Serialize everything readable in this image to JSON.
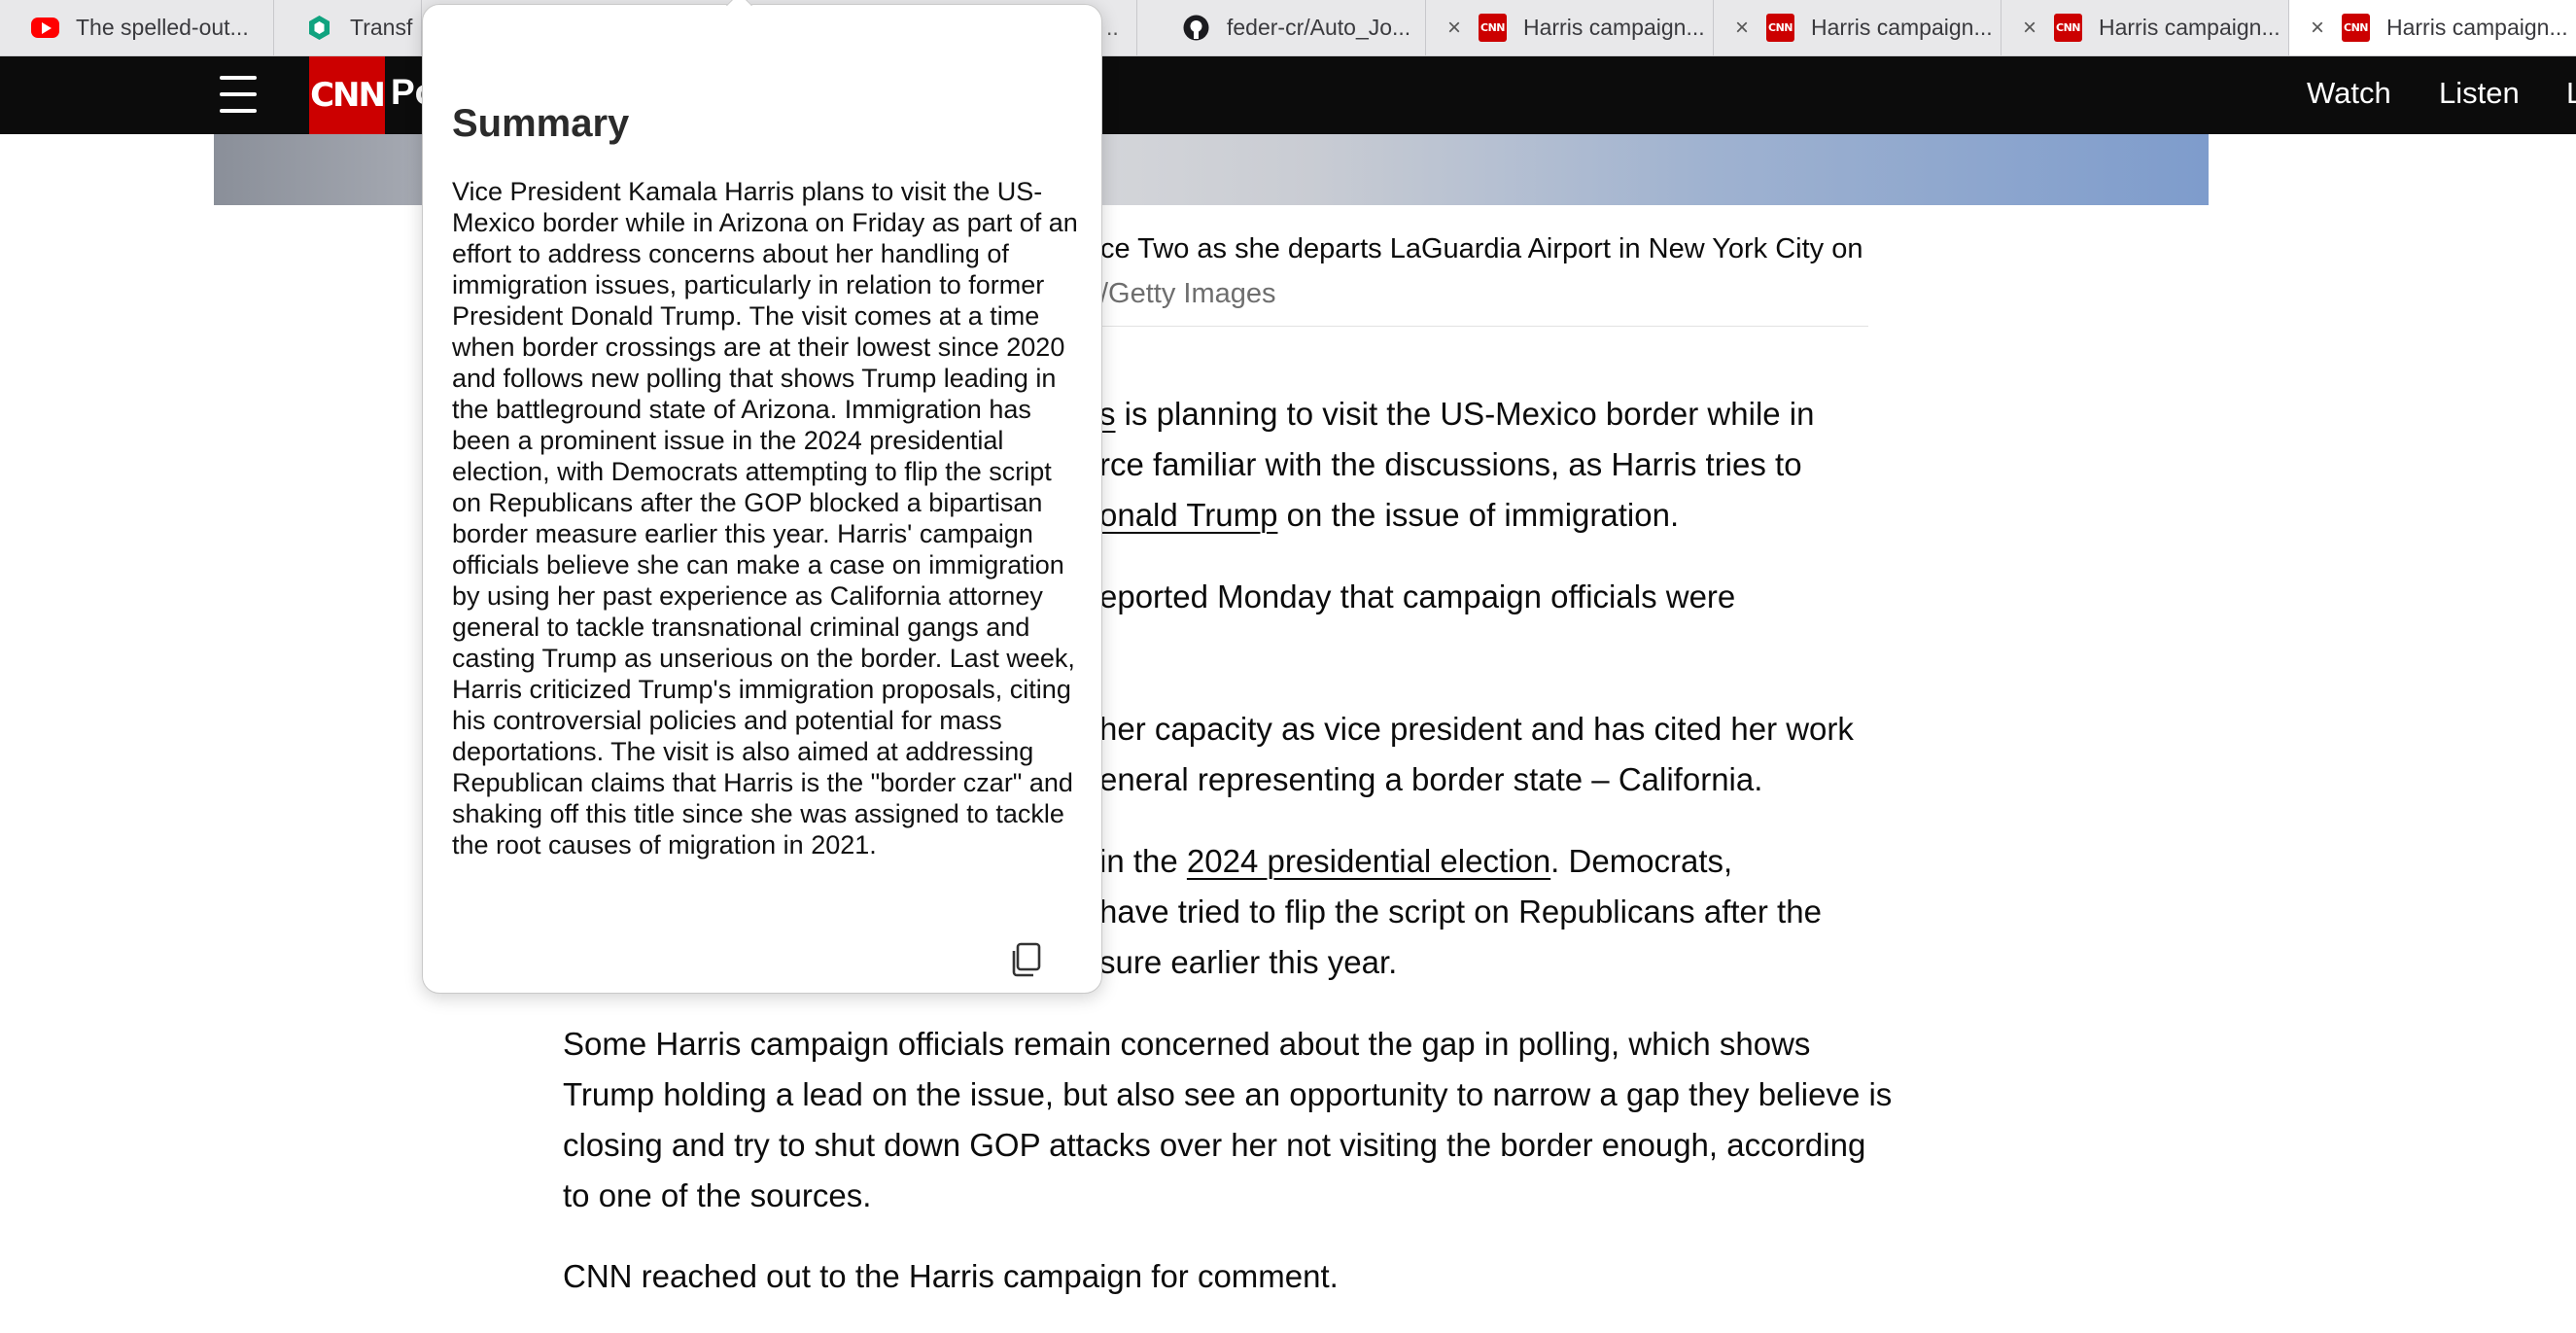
{
  "tabs": [
    {
      "label": "The spelled-out...",
      "icon": "youtube-icon",
      "active": false
    },
    {
      "label": "Transf",
      "icon": "chatgpt-icon",
      "active": false
    },
    {
      "label": "",
      "icon": "",
      "active": false
    },
    {
      "label": "feder-cr/Auto_Jo...",
      "icon": "github-icon",
      "active": false
    },
    {
      "label": "Harris campaign...",
      "icon": "cnn-icon",
      "active": false
    },
    {
      "label": "Harris campaign...",
      "icon": "cnn-icon",
      "active": false
    },
    {
      "label": "Harris campaign...",
      "icon": "cnn-icon",
      "active": false
    },
    {
      "label": "Harris campaign...",
      "icon": "cnn-icon",
      "active": true
    }
  ],
  "tab_close_glyph": "×",
  "header": {
    "logo": "CNN",
    "section": "Po",
    "nav": [
      "Watch",
      "Listen",
      "L"
    ]
  },
  "article": {
    "caption_text": "ce Two as she departs LaGuardia Airport in New York City on",
    "caption_credit": "/Getty Images",
    "p1": {
      "a": "s",
      "b": " is planning to visit the US-Mexico border while in"
    },
    "p1_line2": "rce familiar with the discussions, as Harris tries to",
    "p1_line3": {
      "link": "onald Trump",
      "rest": " on the issue of immigration."
    },
    "p2": "eported Monday that campaign officials were",
    "p3_line1": " her capacity as vice president and has cited her work",
    "p3_line2": "eneral representing a border state – California.",
    "p4_line1": {
      "pre": " in the ",
      "link": "2024 presidential election",
      "post": ". Democrats,"
    },
    "p4_line2": " have tried to flip the script on Republicans after the",
    "p4_line3": "sure earlier this year.",
    "p5": "Some Harris campaign officials remain concerned about the gap in polling, which shows Trump holding a lead on the issue, but also see an opportunity to narrow a gap they believe is closing and try to shut down GOP attacks over her not visiting the border enough, according to one of the sources.",
    "p6": "CNN reached out to the Harris campaign for comment."
  },
  "popup": {
    "title": "Summary",
    "body": "Vice President Kamala Harris plans to visit the US-Mexico border while in Arizona on Friday as part of an effort to address concerns about her handling of immigration issues, particularly in relation to former President Donald Trump. The visit comes at a time when border crossings are at their lowest since 2020 and follows new polling that shows Trump leading in the battleground state of Arizona. Immigration has been a prominent issue in the 2024 presidential election, with Democrats attempting to flip the script on Republicans after the GOP blocked a bipartisan border measure earlier this year. Harris' campaign officials believe she can make a case on immigration by using her past experience as California attorney general to tackle transnational criminal gangs and casting Trump as unserious on the border. Last week, Harris criticized Trump's immigration proposals, citing his controversial policies and potential for mass deportations. The visit is also aimed at addressing Republican claims that Harris is the \"border czar\" and shaking off this title since she was assigned to tackle the root causes of migration in 2021.",
    "copy_icon": "copy-icon"
  },
  "colors": {
    "cnn_red": "#cc0000",
    "header_bg": "#0c0c0c",
    "tab_bg": "#e8e8ea"
  }
}
